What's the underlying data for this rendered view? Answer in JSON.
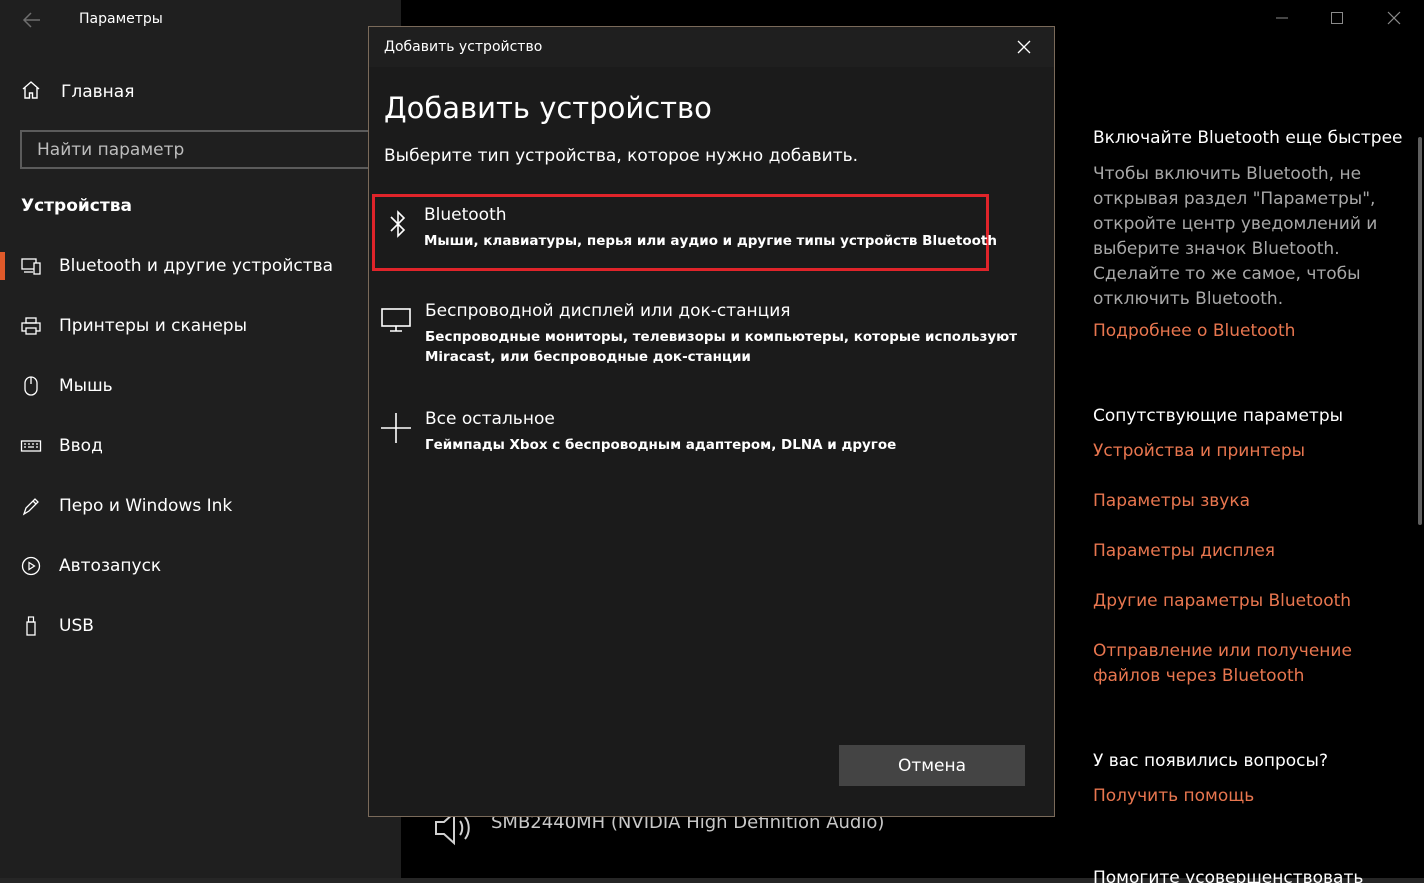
{
  "window": {
    "app_title": "Параметры",
    "back_icon": "back-arrow-icon",
    "controls": [
      "minimize-icon",
      "maximize-icon",
      "close-icon"
    ]
  },
  "sidebar": {
    "home_label": "Главная",
    "search_placeholder": "Найти параметр",
    "section_title": "Устройства",
    "items": [
      {
        "label": "Bluetooth и другие устройства",
        "icon": "bluetooth-devices-icon",
        "active": true
      },
      {
        "label": "Принтеры и сканеры",
        "icon": "printer-icon",
        "active": false
      },
      {
        "label": "Мышь",
        "icon": "mouse-icon",
        "active": false
      },
      {
        "label": "Ввод",
        "icon": "keyboard-icon",
        "active": false
      },
      {
        "label": "Перо и Windows Ink",
        "icon": "pen-icon",
        "active": false
      },
      {
        "label": "Автозапуск",
        "icon": "autoplay-icon",
        "active": false
      },
      {
        "label": "USB",
        "icon": "usb-icon",
        "active": false
      }
    ]
  },
  "right_panel": {
    "quick_heading": "Включайте Bluetooth еще быстрее",
    "quick_text": "Чтобы включить Bluetooth, не открывая раздел \"Параметры\", откройте центр уведомлений и выберите значок Bluetooth. Сделайте то же самое, чтобы отключить Bluetooth.",
    "quick_link": "Подробнее о Bluetooth",
    "related_heading": "Сопутствующие параметры",
    "related_links": [
      "Устройства и принтеры",
      "Параметры звука",
      "Параметры дисплея",
      "Другие параметры Bluetooth",
      "Отправление или получение файлов через Bluetooth"
    ],
    "questions_heading": "У вас появились вопросы?",
    "help_link": "Получить помощь",
    "partial_heading": "Помогите усовершенствовать"
  },
  "background": {
    "device_label": "SMB2440MH (NVIDIA High Definition Audio)"
  },
  "dialog": {
    "window_title": "Добавить устройство",
    "heading": "Добавить устройство",
    "subtitle": "Выберите тип устройства, которое нужно добавить.",
    "options": [
      {
        "title": "Bluetooth",
        "desc": "Мыши, клавиатуры, перья или аудио и другие типы устройств Bluetooth",
        "icon": "bluetooth-icon"
      },
      {
        "title": "Беспроводной дисплей или док-станция",
        "desc": "Беспроводные мониторы, телевизоры и компьютеры, которые используют Miracast, или беспроводные док-станции",
        "icon": "monitor-icon"
      },
      {
        "title": "Все остальное",
        "desc": "Геймпады Xbox с беспроводным адаптером, DLNA и другое",
        "icon": "plus-icon"
      }
    ],
    "cancel_label": "Отмена"
  },
  "colors": {
    "accent": "#e05a2a",
    "link": "#e8764f",
    "highlight_border": "#e0242a"
  }
}
